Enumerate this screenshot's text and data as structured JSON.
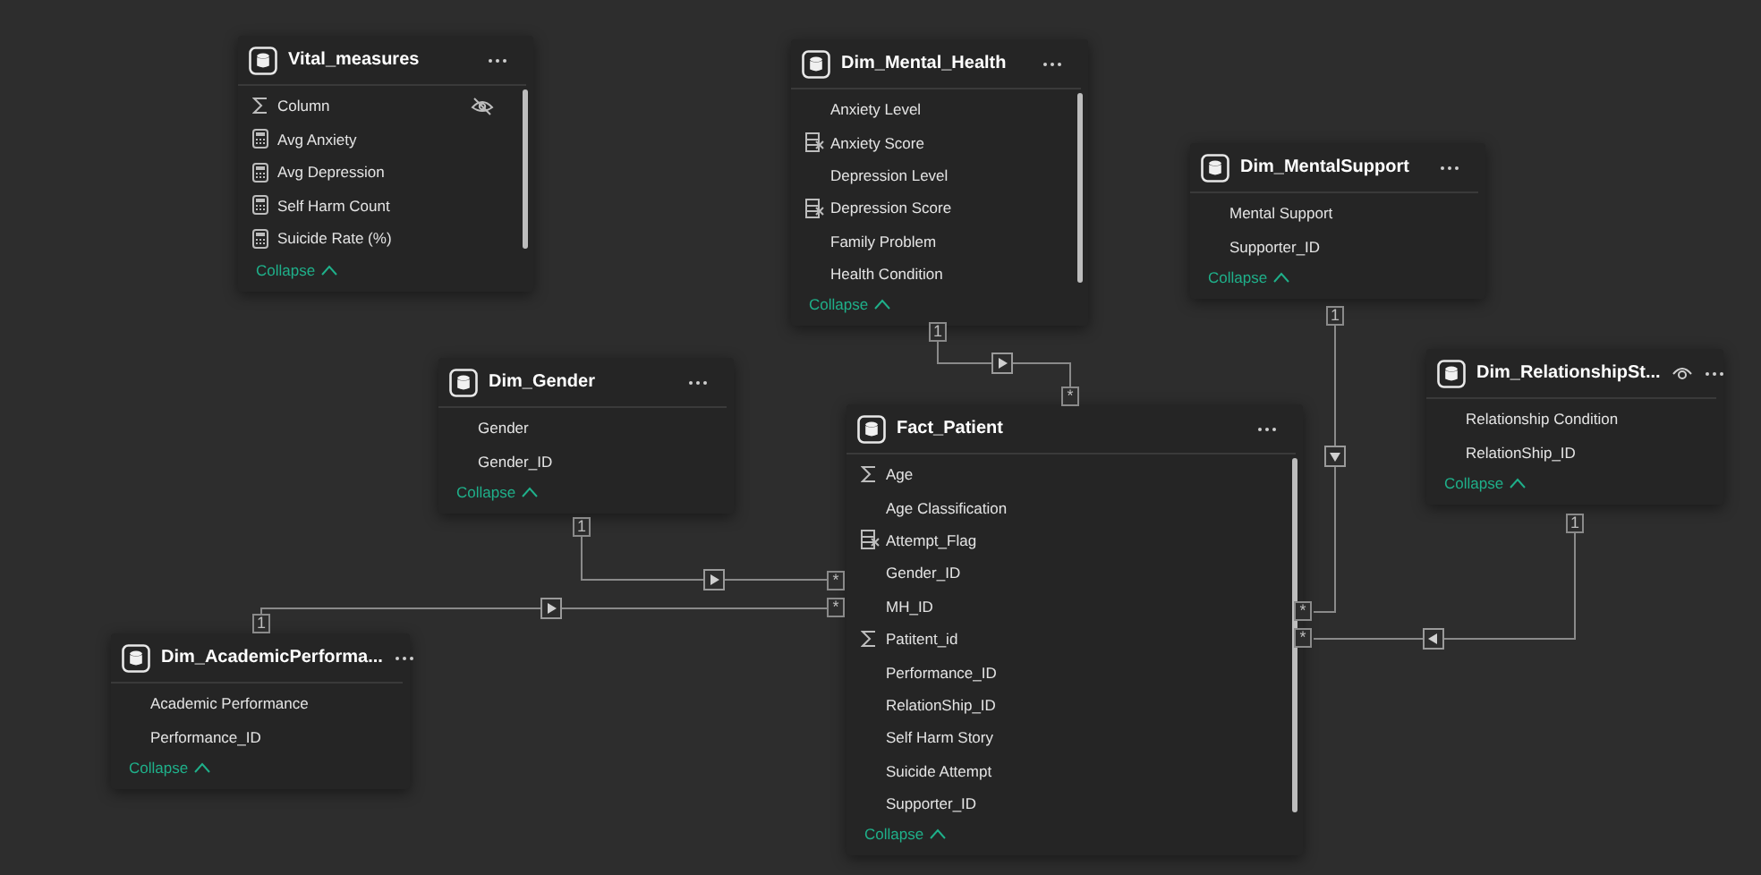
{
  "tables": [
    {
      "title": "Vital_measures",
      "visibility_icon": false,
      "collapse_label": "Collapse",
      "fields": [
        {
          "name": "Column",
          "kind": "sum",
          "hidden": true
        },
        {
          "name": "Avg Anxiety",
          "kind": "measure",
          "hidden": false
        },
        {
          "name": "Avg Depression",
          "kind": "measure",
          "hidden": false
        },
        {
          "name": "Self Harm Count",
          "kind": "measure",
          "hidden": false
        },
        {
          "name": "Suicide Rate (%)",
          "kind": "measure",
          "hidden": false
        }
      ]
    },
    {
      "title": "Dim_Mental_Health",
      "visibility_icon": false,
      "collapse_label": "Collapse",
      "fields": [
        {
          "name": "Anxiety Level",
          "kind": "plain",
          "hidden": false
        },
        {
          "name": "Anxiety Score",
          "kind": "calculated",
          "hidden": false
        },
        {
          "name": "Depression Level",
          "kind": "plain",
          "hidden": false
        },
        {
          "name": "Depression Score",
          "kind": "calculated",
          "hidden": false
        },
        {
          "name": "Family Problem",
          "kind": "plain",
          "hidden": false
        },
        {
          "name": "Health Condition",
          "kind": "plain",
          "hidden": false
        }
      ]
    },
    {
      "title": "Dim_MentalSupport",
      "visibility_icon": false,
      "collapse_label": "Collapse",
      "fields": [
        {
          "name": "Mental Support",
          "kind": "plain",
          "hidden": false
        },
        {
          "name": "Supporter_ID",
          "kind": "plain",
          "hidden": false
        }
      ]
    },
    {
      "title": "Dim_RelationshipSt...",
      "visibility_icon": true,
      "collapse_label": "Collapse",
      "fields": [
        {
          "name": "Relationship Condition",
          "kind": "plain",
          "hidden": false
        },
        {
          "name": "RelationShip_ID",
          "kind": "plain",
          "hidden": false
        }
      ]
    },
    {
      "title": "Dim_Gender",
      "visibility_icon": false,
      "collapse_label": "Collapse",
      "fields": [
        {
          "name": "Gender",
          "kind": "plain",
          "hidden": false
        },
        {
          "name": "Gender_ID",
          "kind": "plain",
          "hidden": false
        }
      ]
    },
    {
      "title": "Fact_Patient",
      "visibility_icon": false,
      "collapse_label": "Collapse",
      "fields": [
        {
          "name": "Age",
          "kind": "sum",
          "hidden": false
        },
        {
          "name": "Age Classification",
          "kind": "plain",
          "hidden": false
        },
        {
          "name": "Attempt_Flag",
          "kind": "calculated",
          "hidden": false
        },
        {
          "name": "Gender_ID",
          "kind": "plain",
          "hidden": false
        },
        {
          "name": "MH_ID",
          "kind": "plain",
          "hidden": false
        },
        {
          "name": "Patitent_id",
          "kind": "sum",
          "hidden": false
        },
        {
          "name": "Performance_ID",
          "kind": "plain",
          "hidden": false
        },
        {
          "name": "RelationShip_ID",
          "kind": "plain",
          "hidden": false
        },
        {
          "name": "Self Harm Story",
          "kind": "plain",
          "hidden": false
        },
        {
          "name": "Suicide Attempt",
          "kind": "plain",
          "hidden": false
        },
        {
          "name": "Supporter_ID",
          "kind": "plain",
          "hidden": false
        }
      ]
    },
    {
      "title": "Dim_AcademicPerforma...",
      "visibility_icon": false,
      "collapse_label": "Collapse",
      "fields": [
        {
          "name": "Academic Performance",
          "kind": "plain",
          "hidden": false
        },
        {
          "name": "Performance_ID",
          "kind": "plain",
          "hidden": false
        }
      ]
    }
  ],
  "relationships": [
    {
      "one_label": "1",
      "many_label": "*"
    },
    {
      "one_label": "1",
      "many_label": "*"
    },
    {
      "one_label": "1",
      "many_label": "*"
    },
    {
      "one_label": "1",
      "many_label": "*"
    },
    {
      "one_label": "1",
      "many_label": "*"
    }
  ]
}
